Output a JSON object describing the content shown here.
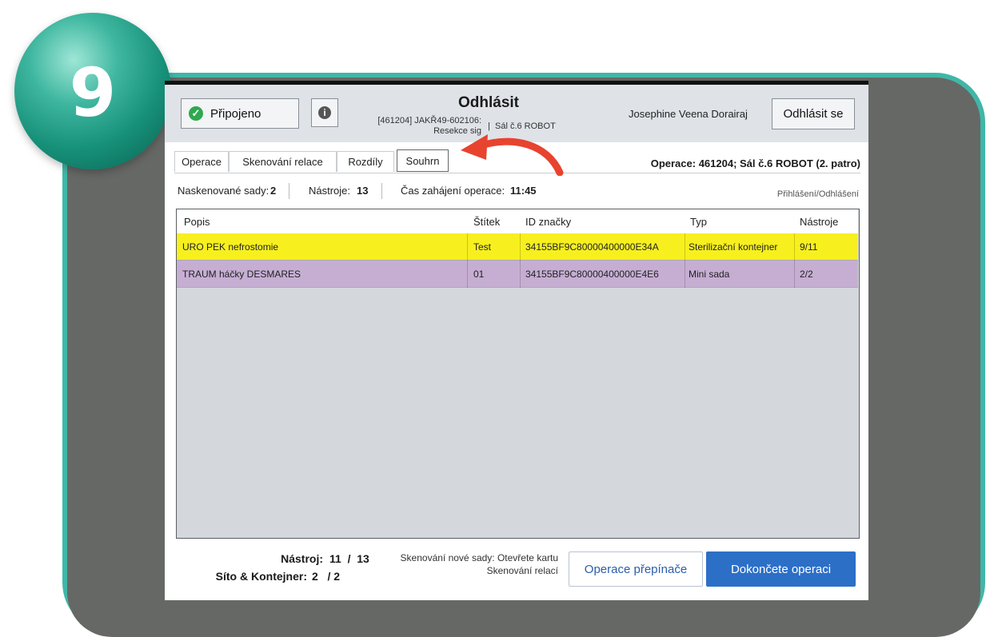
{
  "step": {
    "number": "9"
  },
  "header": {
    "connected_label": "Připojeno",
    "title": "Odhlásit",
    "case_id": "[461204] JAKŘ49-602106:",
    "case_sub": "Resekce sig",
    "separator": "|",
    "room": "Sál č.6 ROBOT",
    "user": "Josephine Veena Dorairaj",
    "logout_label": "Odhlásit se"
  },
  "tabs": [
    {
      "label": "Operace"
    },
    {
      "label": "Skenování relace"
    },
    {
      "label": "Rozdíly"
    },
    {
      "label": "Souhrn"
    }
  ],
  "surgery_info": "Operace: 461204; Sál č.6 ROBOT (2. patro)",
  "stats": {
    "sets_label": "Naskenované sady:",
    "sets_value": "2",
    "tools_label": "Nástroje:",
    "tools_value": "13",
    "start_label": "Čas zahájení operace:",
    "start_value": "11:45",
    "login_link": "Přihlášení/Odhlášení"
  },
  "table": {
    "headers": [
      "Popis",
      "Štítek",
      "ID značky",
      "Typ",
      "Nástroje"
    ],
    "rows": [
      {
        "popis": "URO PEK nefrostomie",
        "stitek": "Test",
        "id": "34155BF9C80000400000E34A",
        "typ": "Sterilizační kontejner",
        "nastroje": "9/11"
      },
      {
        "popis": "TRAUM háčky DESMARES",
        "stitek": "01",
        "id": "34155BF9C80000400000E4E6",
        "typ": "Mini sada",
        "nastroje": "2/2"
      }
    ]
  },
  "footer": {
    "tools_label": "Nástroj:",
    "tools_value": "11  /  13",
    "sieve_label": "Síto & Kontejner:",
    "sieve_value": "2   / 2",
    "note_line1": "Skenování nové sady: Otevřete kartu",
    "note_line2": "Skenování relací",
    "switch_label": "Operace přepínače",
    "finish_label": "Dokončete operaci"
  },
  "colors": {
    "teal_frame": "#3fb7a8",
    "panel_gray": "#666865",
    "row_yellow": "#f7f01e",
    "row_purple": "#c6aed3",
    "finish_blue": "#2c6fc7",
    "arrow_red": "#e8432e"
  },
  "icons": [
    "check-circle-icon",
    "info-icon",
    "curved-arrow-icon"
  ]
}
